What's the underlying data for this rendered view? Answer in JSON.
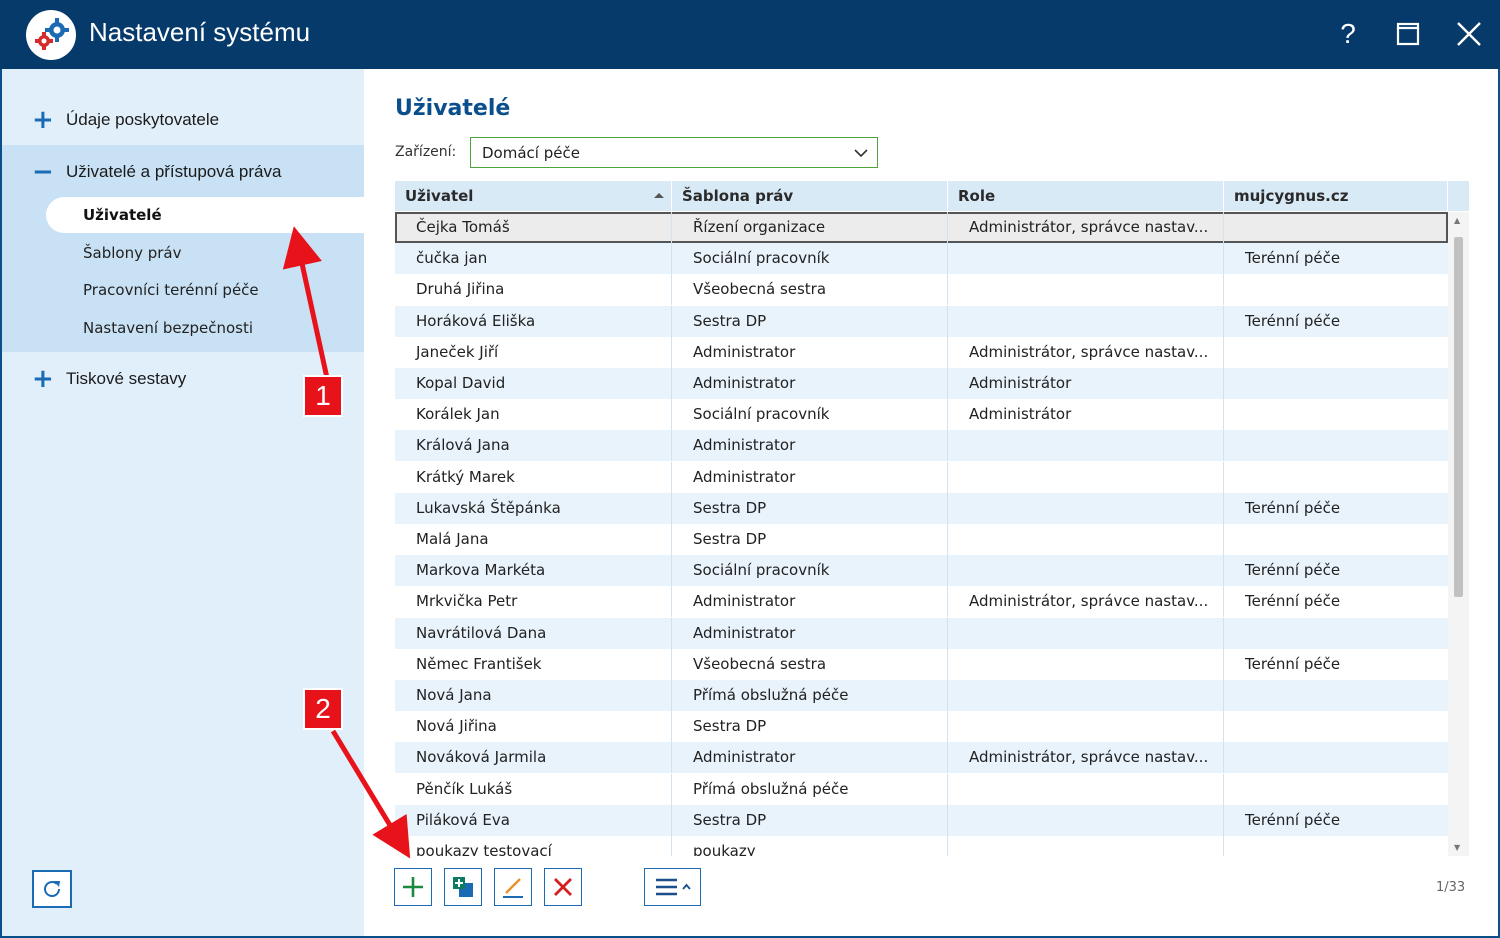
{
  "window": {
    "title": "Nastavení systému",
    "help": "?",
    "accent": "#063a6b"
  },
  "sidebar": {
    "groups": [
      {
        "label": "Údaje poskytovatele",
        "sign": "+"
      },
      {
        "label": "Uživatelé a přístupová práva",
        "sign": "−"
      },
      {
        "label": "Tiskové sestavy",
        "sign": "+"
      }
    ],
    "sub_items": [
      {
        "label": "Uživatelé",
        "active": true
      },
      {
        "label": "Šablony práv"
      },
      {
        "label": "Pracovníci terénní péče"
      },
      {
        "label": "Nastavení bezpečnosti"
      }
    ]
  },
  "main": {
    "title": "Uživatelé",
    "facility_label": "Zařízení:",
    "facility_value": "Domácí péče"
  },
  "grid": {
    "columns": [
      "Uživatel",
      "Šablona práv",
      "Role",
      "mujcygnus.cz"
    ],
    "rows": [
      [
        "Čejka Tomáš",
        "Řízení organizace",
        "Administrátor, správce nastav...",
        ""
      ],
      [
        "čučka jan",
        "Sociální pracovník",
        "",
        "Terénní péče"
      ],
      [
        "Druhá Jiřina",
        "Všeobecná sestra",
        "",
        ""
      ],
      [
        "Horáková Eliška",
        "Sestra DP",
        "",
        "Terénní péče"
      ],
      [
        "Janeček Jiří",
        "Administrator",
        "Administrátor, správce nastav...",
        ""
      ],
      [
        "Kopal David",
        "Administrator",
        "Administrátor",
        ""
      ],
      [
        "Korálek Jan",
        "Sociální pracovník",
        "Administrátor",
        ""
      ],
      [
        "Králová Jana",
        "Administrator",
        "",
        ""
      ],
      [
        "Krátký Marek",
        "Administrator",
        "",
        ""
      ],
      [
        "Lukavská Štěpánka",
        "Sestra DP",
        "",
        "Terénní péče"
      ],
      [
        "Malá Jana",
        "Sestra DP",
        "",
        ""
      ],
      [
        "Markova Markéta",
        "Sociální pracovník",
        "",
        "Terénní péče"
      ],
      [
        "Mrkvička Petr",
        "Administrator",
        "Administrátor, správce nastav...",
        "Terénní péče"
      ],
      [
        "Navrátilová Dana",
        "Administrator",
        "",
        ""
      ],
      [
        "Němec František",
        "Všeobecná sestra",
        "",
        "Terénní péče"
      ],
      [
        "Nová Jana",
        "Přímá obslužná péče",
        "",
        ""
      ],
      [
        "Nová Jiřina",
        "Sestra DP",
        "",
        ""
      ],
      [
        "Nováková Jarmila",
        "Administrator",
        "Administrátor, správce nastav...",
        ""
      ],
      [
        "Pěnčík Lukáš",
        "Přímá obslužná péče",
        "",
        ""
      ],
      [
        "Piláková Eva",
        "Sestra DP",
        "",
        "Terénní péče"
      ],
      [
        "poukazy testovací",
        "poukazy",
        "",
        ""
      ]
    ],
    "selected_row": 0
  },
  "footer": {
    "pager": "1/33"
  },
  "annotations": {
    "callout_1": "1",
    "callout_2": "2",
    "color": "#e8121a"
  },
  "icons": {
    "refresh": "refresh-icon",
    "add": "plus-icon",
    "copy": "copy-add-icon",
    "edit": "pencil-icon",
    "delete": "x-icon",
    "menu": "hamburger-icon"
  }
}
